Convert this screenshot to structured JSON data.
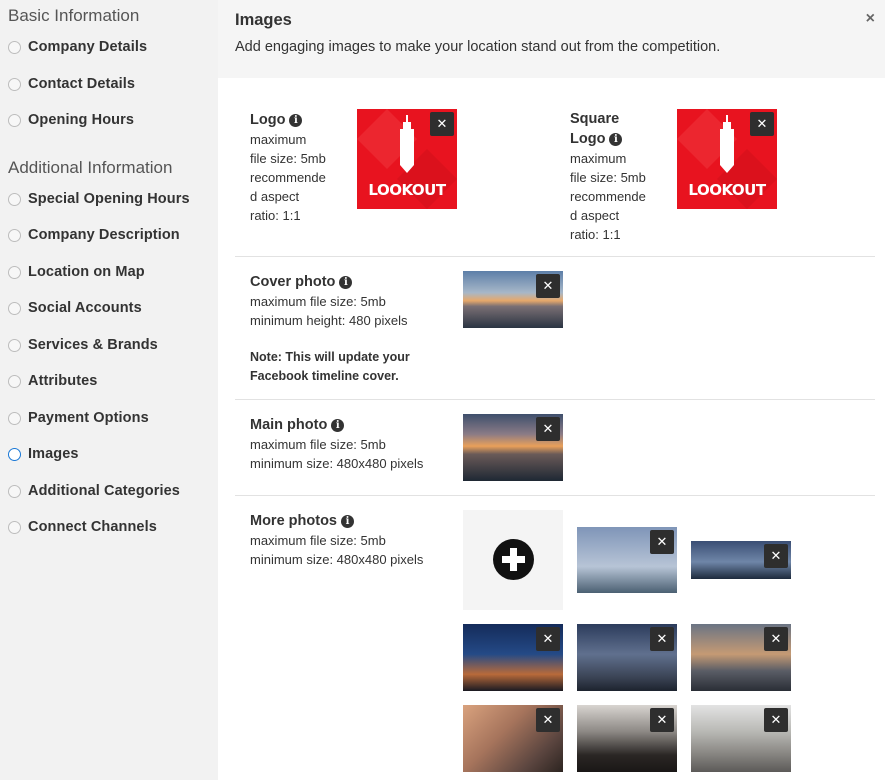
{
  "sidebar": {
    "basic_title": "Basic Information",
    "basic_items": [
      {
        "label": "Company Details",
        "active": false
      },
      {
        "label": "Contact Details",
        "active": false
      },
      {
        "label": "Opening Hours",
        "active": false
      }
    ],
    "additional_title": "Additional Information",
    "additional_items": [
      {
        "label": "Special Opening Hours",
        "active": false
      },
      {
        "label": "Company Description",
        "active": false
      },
      {
        "label": "Location on Map",
        "active": false
      },
      {
        "label": "Social Accounts",
        "active": false
      },
      {
        "label": "Services & Brands",
        "active": false
      },
      {
        "label": "Attributes",
        "active": false
      },
      {
        "label": "Payment Options",
        "active": false
      },
      {
        "label": "Images",
        "active": true
      },
      {
        "label": "Additional Categories",
        "active": false
      },
      {
        "label": "Connect Channels",
        "active": false
      }
    ]
  },
  "header": {
    "title": "Images",
    "description": "Add engaging images to make your location stand out from the competition.",
    "close_glyph": "×"
  },
  "logo": {
    "title": "Logo",
    "lines": [
      "maximum",
      "file size: 5mb",
      "recommende",
      "d aspect",
      "ratio: 1:1"
    ],
    "image_text": "LOOKOUT"
  },
  "square_logo": {
    "title_line1": "Square",
    "title_line2": "Logo",
    "lines": [
      "maximum",
      "file size: 5mb",
      "recommende",
      "d aspect",
      "ratio: 1:1"
    ],
    "image_text": "LOOKOUT"
  },
  "cover_photo": {
    "title": "Cover photo",
    "lines": [
      "maximum file size: 5mb",
      "minimum height: 480 pixels"
    ],
    "note_line1": "Note: This will update your",
    "note_line2": "Facebook timeline cover."
  },
  "main_photo": {
    "title": "Main photo",
    "lines": [
      "maximum file size: 5mb",
      "minimum size: 480x480 pixels"
    ]
  },
  "more_photos": {
    "title": "More photos",
    "lines": [
      "maximum file size: 5mb",
      "minimum size: 480x480 pixels"
    ]
  },
  "delete_glyph": "✕",
  "info_glyph": "i",
  "colors": {
    "active_radio": "#1a78d6",
    "logo_red": "#e8131f",
    "delete_button": "#2e2e2e"
  }
}
